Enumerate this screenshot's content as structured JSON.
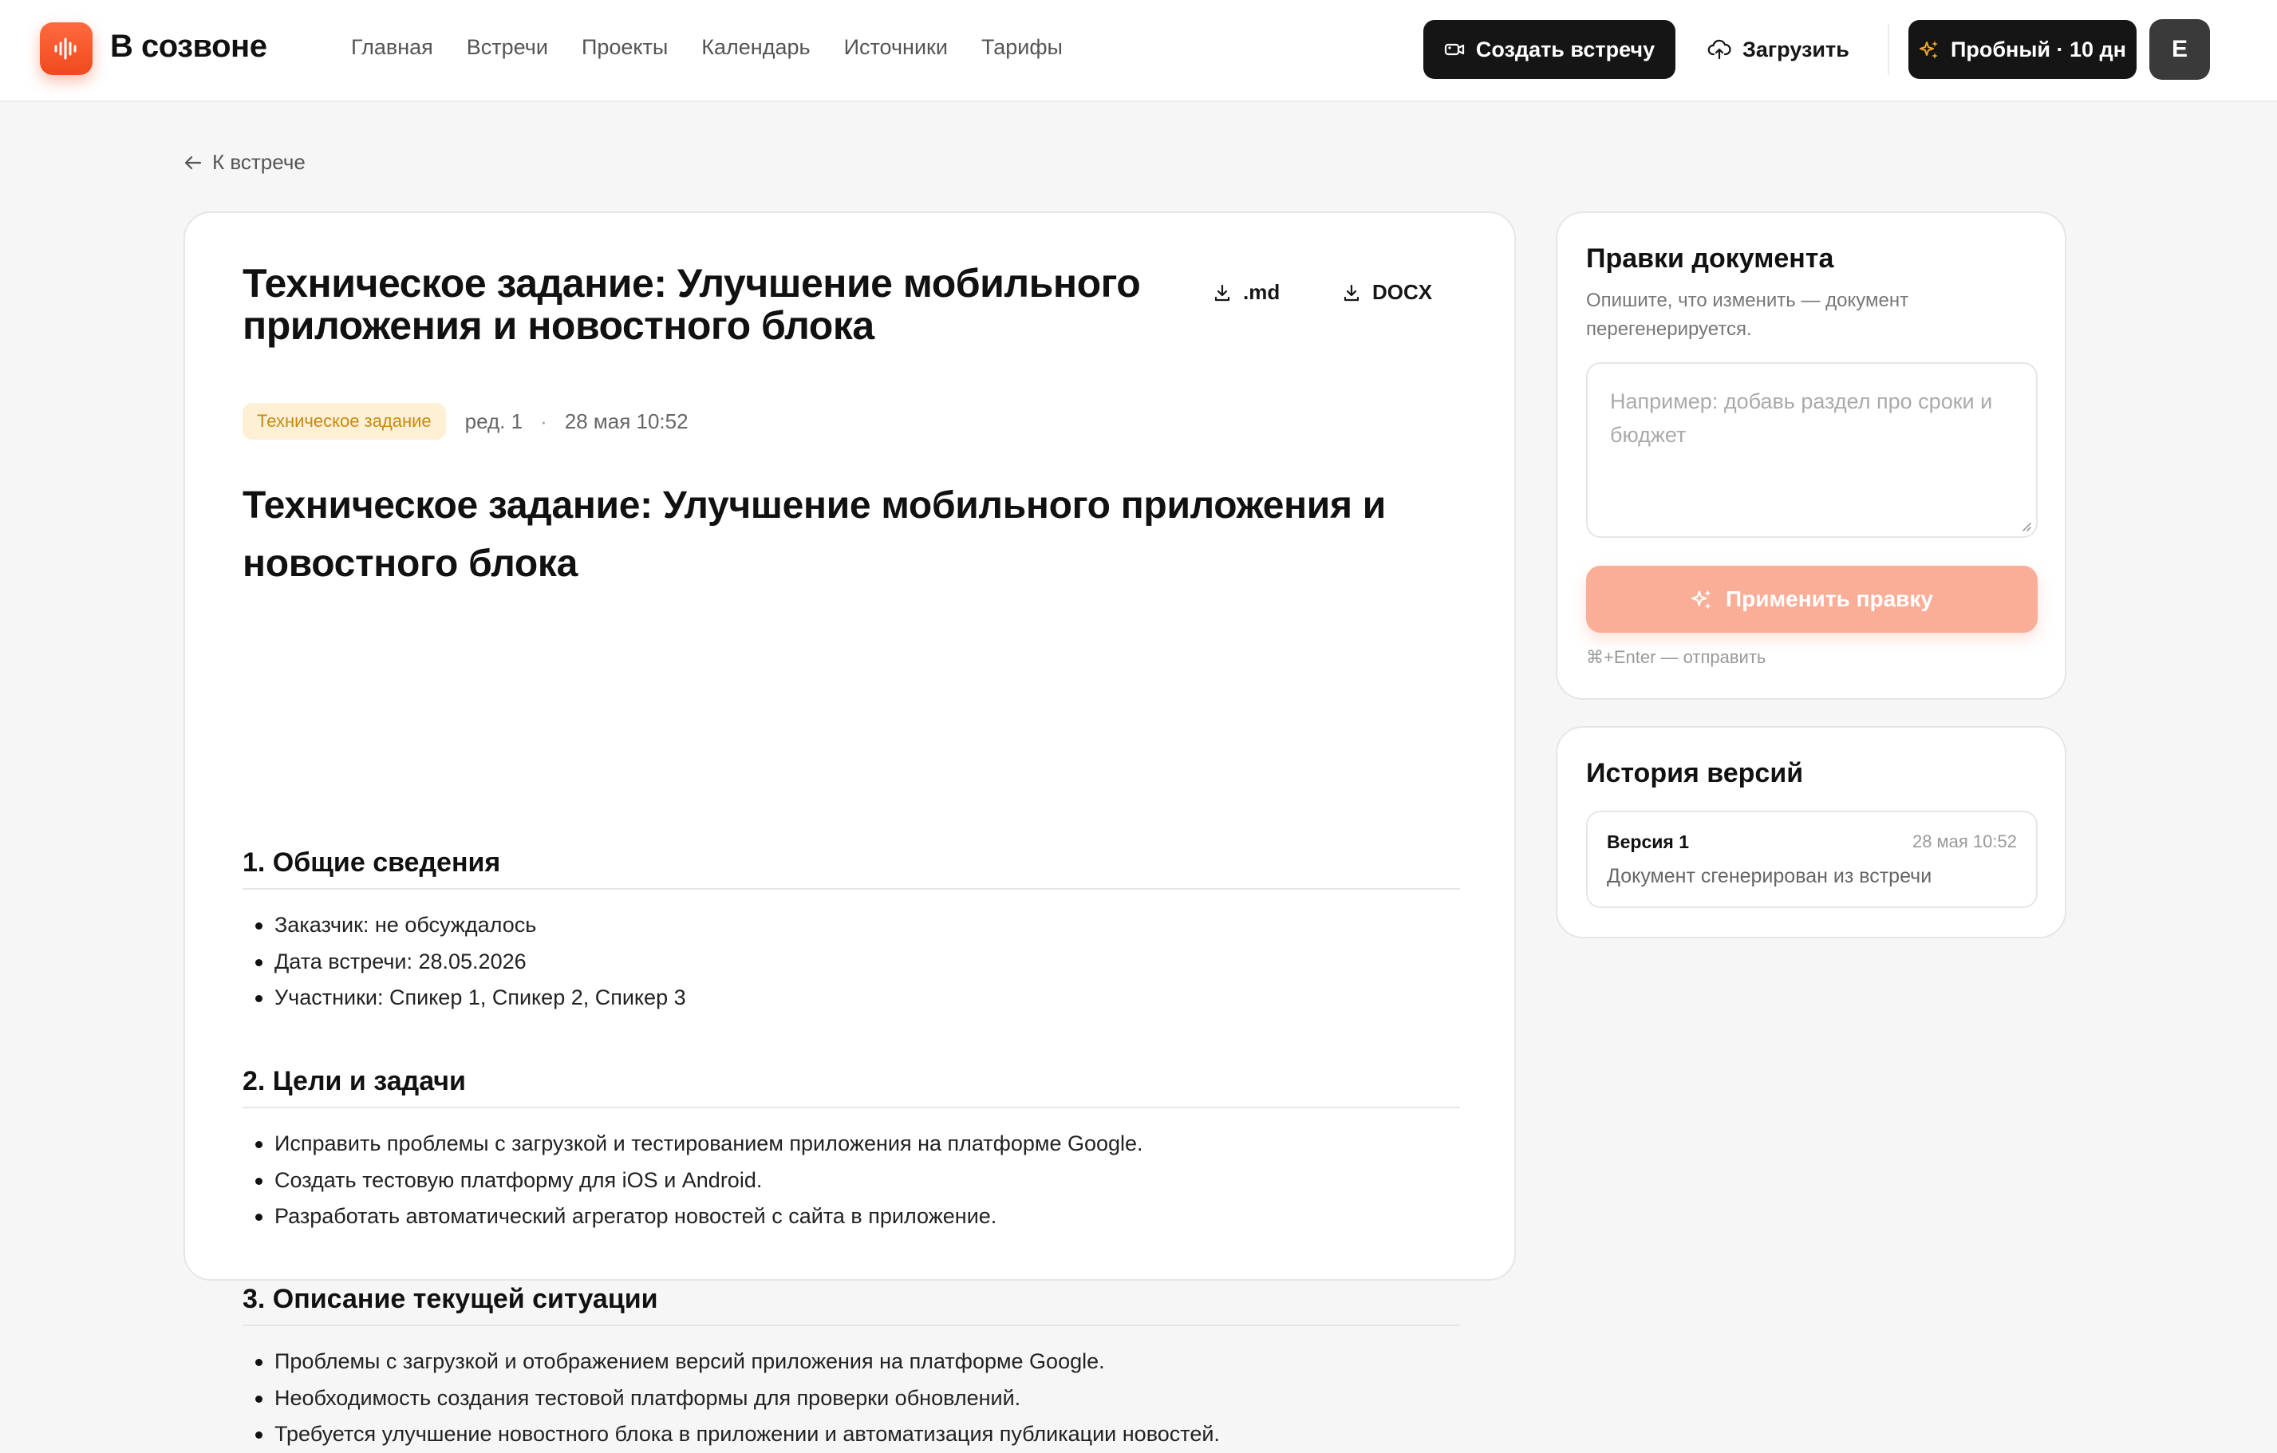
{
  "header": {
    "brand": "В созвоне",
    "nav": [
      "Главная",
      "Встречи",
      "Проекты",
      "Календарь",
      "Источники",
      "Тарифы"
    ],
    "create_meeting": "Создать встречу",
    "upload": "Загрузить",
    "trial": "Пробный · 10 дн",
    "avatar_letter": "E"
  },
  "back_link": "К встрече",
  "document": {
    "title": "Техническое задание: Улучшение мобильного приложения и новостного блока",
    "download_md": ".md",
    "download_docx": "DOCX",
    "tag": "Техническое задание",
    "revision": "ред. 1",
    "date": "28 мая 10:52",
    "heading": "Техническое задание: Улучшение мобильного приложения и новостного блока",
    "sections": [
      {
        "title": "1. Общие сведения",
        "items": [
          "Заказчик: не обсуждалось",
          "Дата встречи: 28.05.2026",
          "Участники: Спикер 1, Спикер 2, Спикер 3"
        ]
      },
      {
        "title": "2. Цели и задачи",
        "items": [
          "Исправить проблемы с загрузкой и тестированием приложения на платформе Google.",
          "Создать тестовую платформу для iOS и Android.",
          "Разработать автоматический агрегатор новостей с сайта в приложение."
        ]
      },
      {
        "title": "3. Описание текущей ситуации",
        "items": [
          "Проблемы с загрузкой и отображением версий приложения на платформе Google.",
          "Необходимость создания тестовой платформы для проверки обновлений.",
          "Требуется улучшение новостного блока в приложении и автоматизация публикации новостей."
        ]
      }
    ]
  },
  "edits": {
    "title": "Правки документа",
    "subtitle": "Опишите, что изменить — документ перегенерируется.",
    "placeholder": "Например: добавь раздел про сроки и бюджет",
    "apply": "Применить правку",
    "hint": "⌘+Enter — отправить"
  },
  "history": {
    "title": "История версий",
    "versions": [
      {
        "name": "Версия 1",
        "date": "28 мая 10:52",
        "description": "Документ сгенерирован из встречи"
      }
    ]
  },
  "colors": {
    "brand": "#f04a1f",
    "apply_disabled": "#fbae97",
    "tag_bg": "#fdf0d4",
    "tag_text": "#c98a10"
  }
}
